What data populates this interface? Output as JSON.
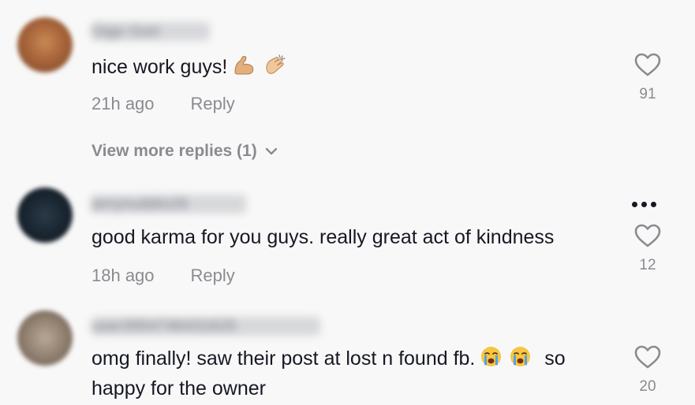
{
  "comments": [
    {
      "username": "Gigo Gori",
      "text": "nice work guys!",
      "time": "21h ago",
      "reply_label": "Reply",
      "likes": "91",
      "icons": [
        "flexed-biceps-emoji",
        "clapping-hands-emoji"
      ]
    },
    {
      "username": "jerrynuddin29",
      "text": "good karma for you guys. really great act of kindness",
      "time": "18h ago",
      "reply_label": "Reply",
      "likes": "12"
    },
    {
      "username": "user3954746431625",
      "text_before": "omg finally! saw their post at lost n found fb.",
      "text_after": "so",
      "text_line2": "happy for the owner",
      "likes": "20",
      "icons": [
        "loudly-crying-face-emoji",
        "loudly-crying-face-emoji"
      ]
    }
  ],
  "view_more_replies": "View more replies (1)",
  "colors": {
    "text": "#161823",
    "secondary": "#8a8b91",
    "background": "#f8f8f8"
  }
}
